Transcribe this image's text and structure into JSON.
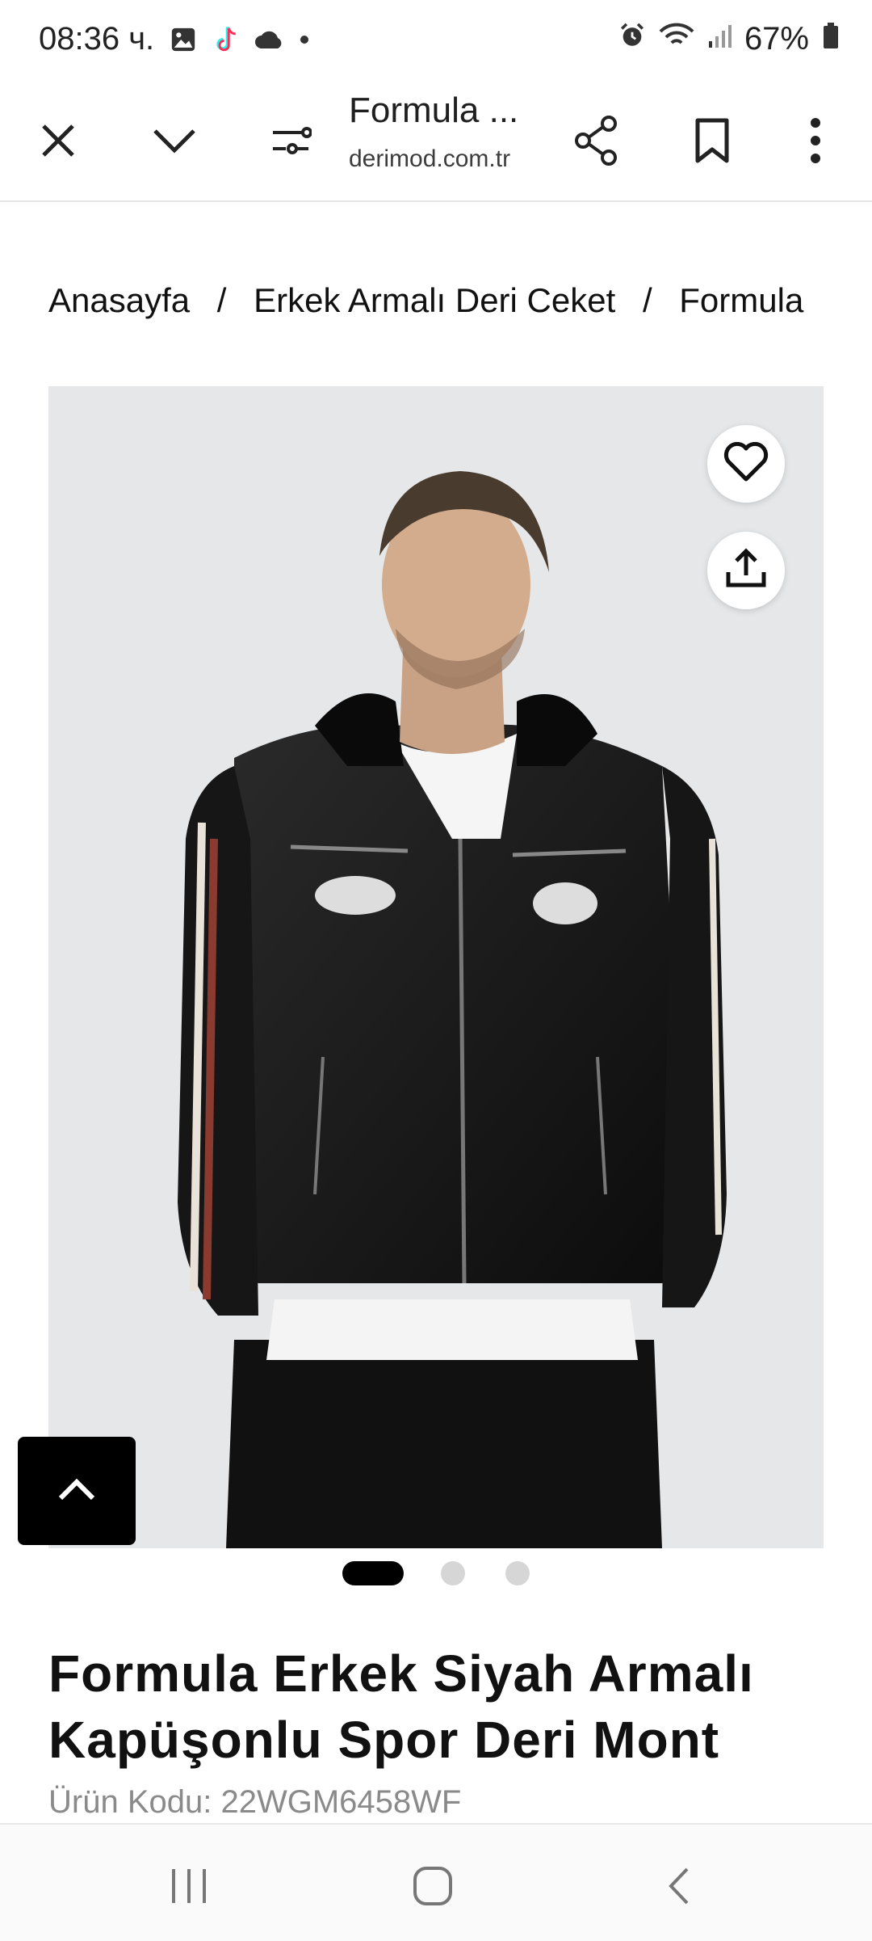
{
  "status_bar": {
    "time": "08:36 ч.",
    "battery": "67%",
    "icons": [
      "gallery-icon",
      "tiktok-icon",
      "cloud-icon",
      "dot-icon",
      "alarm-icon",
      "wifi-icon",
      "signal-icon",
      "battery-icon"
    ]
  },
  "toolbar": {
    "title": "Formula ...",
    "url": "derimod.com.tr",
    "icons": [
      "close-icon",
      "chevron-down-icon",
      "tune-icon",
      "share-icon",
      "bookmark-icon",
      "more-vert-icon"
    ]
  },
  "breadcrumb": {
    "items": [
      "Anasayfa",
      "Erkek Armalı Deri Ceket",
      "Formula"
    ],
    "separator": "/"
  },
  "product": {
    "image_alt": "Black leather jacket with hood",
    "favorite_icon": "heart-icon",
    "share_icon": "upload-icon",
    "carousel": {
      "count": 3,
      "active": 0
    },
    "title": "Formula Erkek Siyah Armalı Kapüşonlu Spor Deri Mont",
    "code": "Ürün Kodu: 22WGM6458WF"
  },
  "colors": {
    "accent": "#000000",
    "dot_inactive": "#d6d6d6",
    "image_bg": "#e5e7e9"
  }
}
